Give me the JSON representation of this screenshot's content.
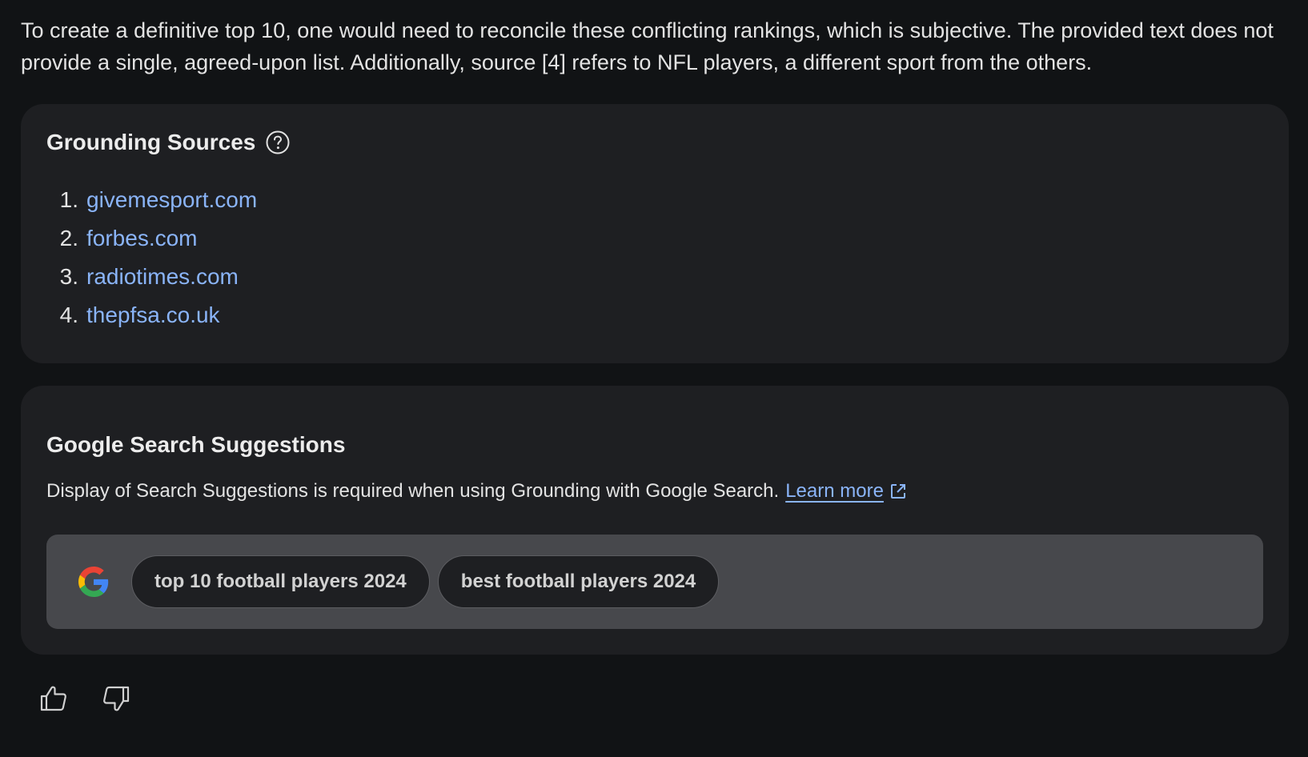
{
  "intro_text": "To create a definitive top 10, one would need to reconcile these conflicting rankings, which is subjective. The provided text does not provide a single, agreed-upon list. Additionally, source [4] refers to NFL players, a different sport from the others.",
  "grounding": {
    "title": "Grounding Sources",
    "help_icon": "help-circle-icon",
    "sources": [
      {
        "num": "1.",
        "label": "givemesport.com"
      },
      {
        "num": "2.",
        "label": "forbes.com"
      },
      {
        "num": "3.",
        "label": "radiotimes.com"
      },
      {
        "num": "4.",
        "label": "thepfsa.co.uk"
      }
    ]
  },
  "suggestions": {
    "title": "Google Search Suggestions",
    "description": "Display of Search Suggestions is required when using Grounding with Google Search.",
    "learn_more": "Learn more",
    "learn_more_icon": "external-link-icon",
    "logo_icon": "google-logo-icon",
    "chips": [
      "top 10 football players 2024",
      "best football players 2024"
    ]
  },
  "feedback": {
    "thumbs_up_icon": "thumbs-up-icon",
    "thumbs_down_icon": "thumbs-down-icon"
  },
  "colors": {
    "background": "#111315",
    "card": "#1e1f22",
    "chip_bar": "#47484c",
    "link": "#8ab4f8",
    "text": "#e3e3e3"
  }
}
